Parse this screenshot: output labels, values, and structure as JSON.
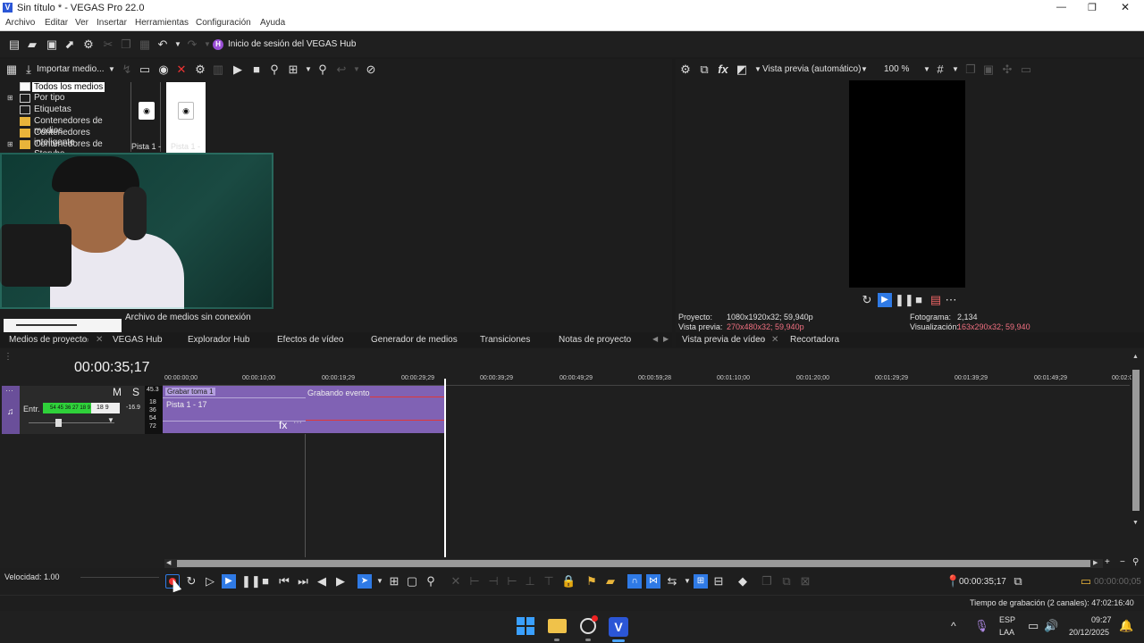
{
  "window": {
    "title": "Sin título * - VEGAS Pro 22.0",
    "controls": [
      "—",
      "❐",
      "✕"
    ]
  },
  "menu": [
    "Archivo",
    "Editar",
    "Ver",
    "Insertar",
    "Herramientas",
    "Configuración",
    "Ayuda"
  ],
  "toolbar": {
    "hub_letter": "H",
    "hub_label": "Inicio de sesión del VEGAS Hub"
  },
  "media": {
    "import_label": "Importar medio...",
    "tree": [
      "Todos los medios",
      "Por tipo",
      "Etiquetas",
      "Contenedores de medios",
      "Contenedores inteligente",
      "Contenedores de Storybo"
    ],
    "thumbs": [
      "Pista 1 -",
      "Pista 1 -"
    ],
    "offline_label": "Archivo de medios sin conexión"
  },
  "preview": {
    "mode_label": "Vista previa (automático)",
    "zoom": "100 %",
    "project_label": "Proyecto:",
    "project_value": "1080x1920x32; 59,940p",
    "preview_label": "Vista previa:",
    "preview_value": "270x480x32; 59,940p",
    "frame_label": "Fotograma:",
    "frame_value": "2,134",
    "display_label": "Visualización:",
    "display_value": "163x290x32; 59,940"
  },
  "dock_tabs": [
    "Medios de proyecto",
    "VEGAS Hub",
    "Explorador Hub",
    "Efectos de vídeo",
    "Generador de medios",
    "Transiciones",
    "Notas de proyecto"
  ],
  "preview_tabs": [
    "Vista previa de vídeo",
    "Recortadora"
  ],
  "timeline": {
    "timecode": "00:00:35;17",
    "ruler": [
      "00:00:00;00",
      "00:00:10;00",
      "00:00:19;29",
      "00:00:29;29",
      "00:00:39;29",
      "00:00:49;29",
      "00:00:59;28",
      "00:01:10;00",
      "00:01:20;00",
      "00:01:29;29",
      "00:01:39;29",
      "00:01:49;29",
      "00:02:0"
    ],
    "track": {
      "m": "M",
      "s": "S",
      "level": "45.3",
      "input_label": "Entr.",
      "meter_text": "54  45  36  27  18   9",
      "db": "-16.9",
      "scale": [
        "18",
        "36",
        "54",
        "72"
      ]
    },
    "clip1_take": "Grabar toma 1",
    "clip1_name": "Pista 1 - 17",
    "clip2_name": "Grabando evento",
    "fx": "fx"
  },
  "transport": {
    "speed": "Velocidad: 1.00",
    "cursor_time": "00:00:35;17",
    "end_time": "00:00:00;05"
  },
  "status": {
    "rec_time": "Tiempo de grabación (2 canales): 47:02:16:40"
  },
  "taskbar": {
    "lang1": "ESP",
    "lang2": "LAA",
    "time": "09:27",
    "date": "20/12/2025",
    "v": "V"
  }
}
